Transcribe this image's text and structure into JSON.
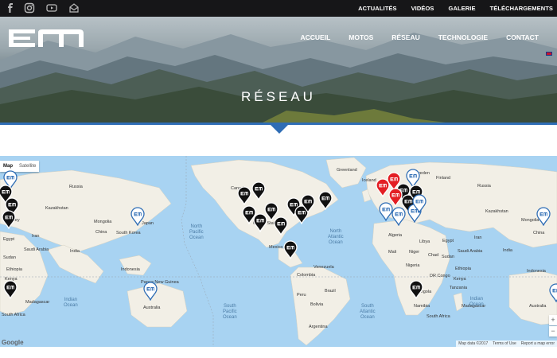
{
  "topbar": {
    "social_icons": [
      "facebook-icon",
      "instagram-icon",
      "youtube-icon",
      "mail-icon"
    ],
    "links": [
      "ACTUALITÉS",
      "VIDÉOS",
      "GALERIE",
      "TÉLÉCHARGEMENTS"
    ]
  },
  "header": {
    "logo_icon": "em-logo",
    "nav": [
      "ACCUEIL",
      "MOTOS",
      "RÉSEAU",
      "TECHNOLOGIE",
      "CONTACT"
    ],
    "language_icon": "uk-flag-icon",
    "hero_title": "RÉSEAU"
  },
  "map": {
    "type_buttons": {
      "map": "Map",
      "satellite": "Satellite"
    },
    "country_labels": {
      "russia_l": "Russia",
      "kazakhstan": "Kazakhstan",
      "mongolia": "Mongolia",
      "china": "China",
      "india": "India",
      "iran": "Iran",
      "turkey": "Turkey",
      "saudi": "Saudi Arabia",
      "libya": "Libya",
      "egypt": "Egypt",
      "sudan": "Sudan",
      "ethiopia": "Ethiopia",
      "kenya": "Kenya",
      "japan": "Japan",
      "south_korea": "South Korea",
      "indonesia": "Indonesia",
      "papua": "Papua New Guinea",
      "australia": "Australia",
      "madagascar": "Madagascar",
      "drcongo": "DR Congo",
      "tanzania": "Tanzania",
      "angola": "Angola",
      "namibia": "Namibia",
      "south_africa": "South Africa",
      "canada": "Canada",
      "united_states": "United States",
      "mexico": "Mexico",
      "venezuela": "Venezuela",
      "colombia": "Colombia",
      "peru": "Peru",
      "brazil": "Brazil",
      "bolivia": "Bolivia",
      "argentina": "Argentina",
      "greenland": "Greenland",
      "iceland": "Iceland",
      "sweden": "Sweden",
      "finland": "Finland",
      "russia_r": "Russia",
      "kazakhstan_r": "Kazakhstan",
      "algeria": "Algeria",
      "mali": "Mali",
      "niger": "Niger",
      "chad": "Chad",
      "nigeria": "Nigeria",
      "sudan_r": "Sudan",
      "mongolia_r": "Mongolia",
      "china_r": "China",
      "iran_r": "Iran",
      "libya_r": "Libya",
      "egypt_r": "Egypt",
      "saudi_r": "Saudi Arabia",
      "india_r": "India",
      "ethiopia_r": "Ethiopia",
      "kenya_r": "Kenya",
      "tanzania_r": "Tanzania",
      "drc_r": "DR Congo",
      "angola_r": "Angola",
      "namibia_r": "Namibia",
      "south_africa_r": "South Africa",
      "madagascar_r": "Madagascar",
      "indonesia_r": "Indonesia",
      "australia_r": "Australia"
    },
    "oceans": {
      "north_pacific": "North\nPacific\nOcean",
      "north_atlantic": "North\nAtlantic\nOcean",
      "south_pacific": "South\nPacific\nOcean",
      "south_atlantic": "South\nAtlantic\nOcean",
      "indian_l": "Indian\nOcean",
      "indian_r": "Indian\nOcean"
    },
    "zoom": {
      "in": "+",
      "out": "−"
    },
    "attribution": {
      "data": "Map data ©2017",
      "terms": "Terms of Use",
      "report": "Report a map error"
    },
    "google_logo": "Google",
    "marker_icon": "em-dealer-marker-icon",
    "colors": {
      "ocean": "#a8d3f2",
      "land": "#f2efe6",
      "accent": "#2f6db5",
      "marker_black": "#111111",
      "marker_red": "#e31e24"
    }
  }
}
